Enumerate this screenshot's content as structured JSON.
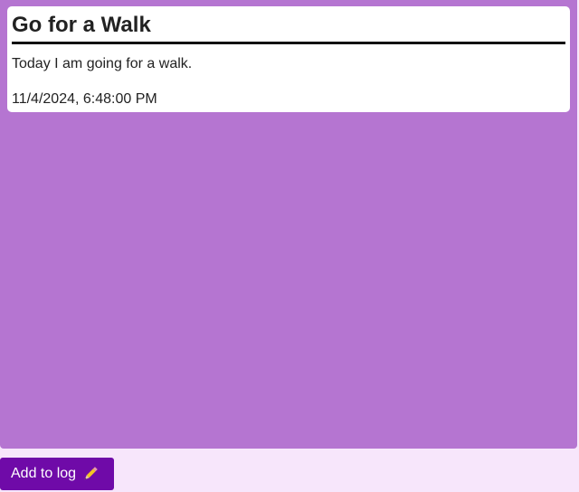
{
  "log": {
    "entries": [
      {
        "title": "Go for a Walk",
        "body": "Today I am going for a walk.",
        "timestamp": "11/4/2024, 6:48:00 PM"
      }
    ]
  },
  "actions": {
    "add_label": "Add to log",
    "add_icon": "pencil-icon"
  },
  "colors": {
    "page_background": "#f7e6fb",
    "panel_background": "#b575d1",
    "card_background": "#ffffff",
    "button_background": "#6f0aa8",
    "button_text": "#ffffff"
  }
}
